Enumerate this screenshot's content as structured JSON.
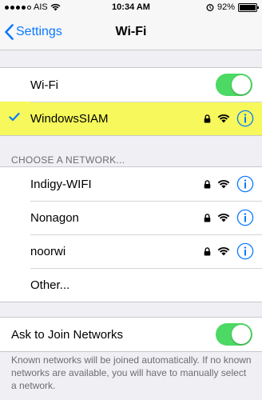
{
  "status_bar": {
    "carrier": "AIS",
    "time": "10:34 AM",
    "battery_percent": "92%",
    "battery_level": 0.92,
    "signal_bars": 4,
    "icons": [
      "signal-dots-icon",
      "wifi-icon",
      "alarm-clock-icon",
      "battery-icon"
    ]
  },
  "nav": {
    "back_label": "Settings",
    "title": "Wi-Fi"
  },
  "wifi_group": {
    "wifi_label": "Wi-Fi",
    "wifi_enabled": true,
    "connected_network": "WindowsSIAM",
    "highlight_color": "#f6f85b"
  },
  "networks": {
    "header": "CHOOSE A NETWORK...",
    "items": [
      {
        "name": "Indigy-WIFI",
        "secured": true
      },
      {
        "name": "Nonagon",
        "secured": true
      },
      {
        "name": "noorwi",
        "secured": true
      }
    ],
    "other_label": "Other..."
  },
  "ask_join": {
    "label": "Ask to Join Networks",
    "enabled": true,
    "footer": "Known networks will be joined automatically. If no known networks are available, you will have to manually select a network."
  },
  "colors": {
    "accent": "#0a7aff",
    "toggle_on": "#4cd964",
    "background": "#efeff4"
  }
}
